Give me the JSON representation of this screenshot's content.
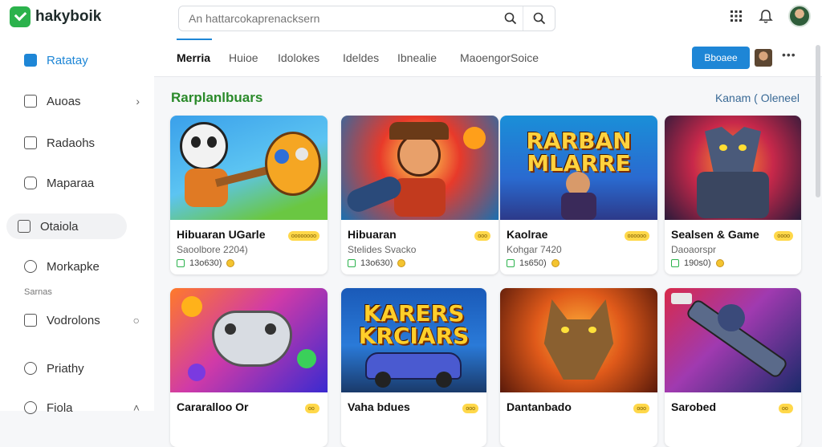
{
  "app": {
    "name": "hakyboik"
  },
  "search": {
    "placeholder": "An hattarcokaprenacksern"
  },
  "sidebar": {
    "items": [
      {
        "label": "Ratatay"
      },
      {
        "label": "Auoas"
      },
      {
        "label": "Radaohs"
      },
      {
        "label": "Maparaa"
      },
      {
        "label": "Otaiola"
      },
      {
        "label": "Morkapke"
      },
      {
        "label": "Vodrolons"
      },
      {
        "label": "Priathy"
      },
      {
        "label": "Fiola"
      }
    ],
    "section_label": "Sarnas"
  },
  "tabs": {
    "items": [
      "Merria",
      "Huioe",
      "Idolokes",
      "Ideldes",
      "Ibnealie",
      "MaoengorSoice"
    ],
    "button_label": "Bboaee"
  },
  "section": {
    "title": "Rarplanlbuars",
    "link": "Kanam ( Oleneel"
  },
  "cards": [
    {
      "title": "Hibuaran UGarle",
      "sub": "Saoolbore 2204)",
      "meta": "13o630)",
      "badge": "oooooooo",
      "art": "panda"
    },
    {
      "title": "Hibuaran",
      "sub": "Stelides Svacko",
      "meta": "13o630)",
      "badge": "ooo",
      "art": "hero"
    },
    {
      "title": "Kaolrae",
      "sub": "Kohgar 7420",
      "meta": "1s650)",
      "badge": "oooooo",
      "art": "marban",
      "art_text": [
        "RARBAN",
        "MLARRE"
      ]
    },
    {
      "title": "Sealsen & Game",
      "sub": "Daoaorspr",
      "meta": "190s0)",
      "badge": "oooo",
      "art": "knight"
    },
    {
      "title": "Cararalloo Or",
      "sub": "",
      "meta": "",
      "badge": "oo",
      "art": "controller"
    },
    {
      "title": "Vaha bdues",
      "sub": "",
      "meta": "",
      "badge": "ooo",
      "art": "car",
      "art_text": [
        "KARERS",
        "KRCIARS"
      ]
    },
    {
      "title": "Dantanbado",
      "sub": "",
      "meta": "",
      "badge": "ooo",
      "art": "dragon"
    },
    {
      "title": "Sarobed",
      "sub": "",
      "meta": "",
      "badge": "oo",
      "art": "robot"
    }
  ],
  "colors": {
    "accent": "#1e86d6",
    "brand": "#2bb24c",
    "section_title": "#2a8a2a"
  }
}
